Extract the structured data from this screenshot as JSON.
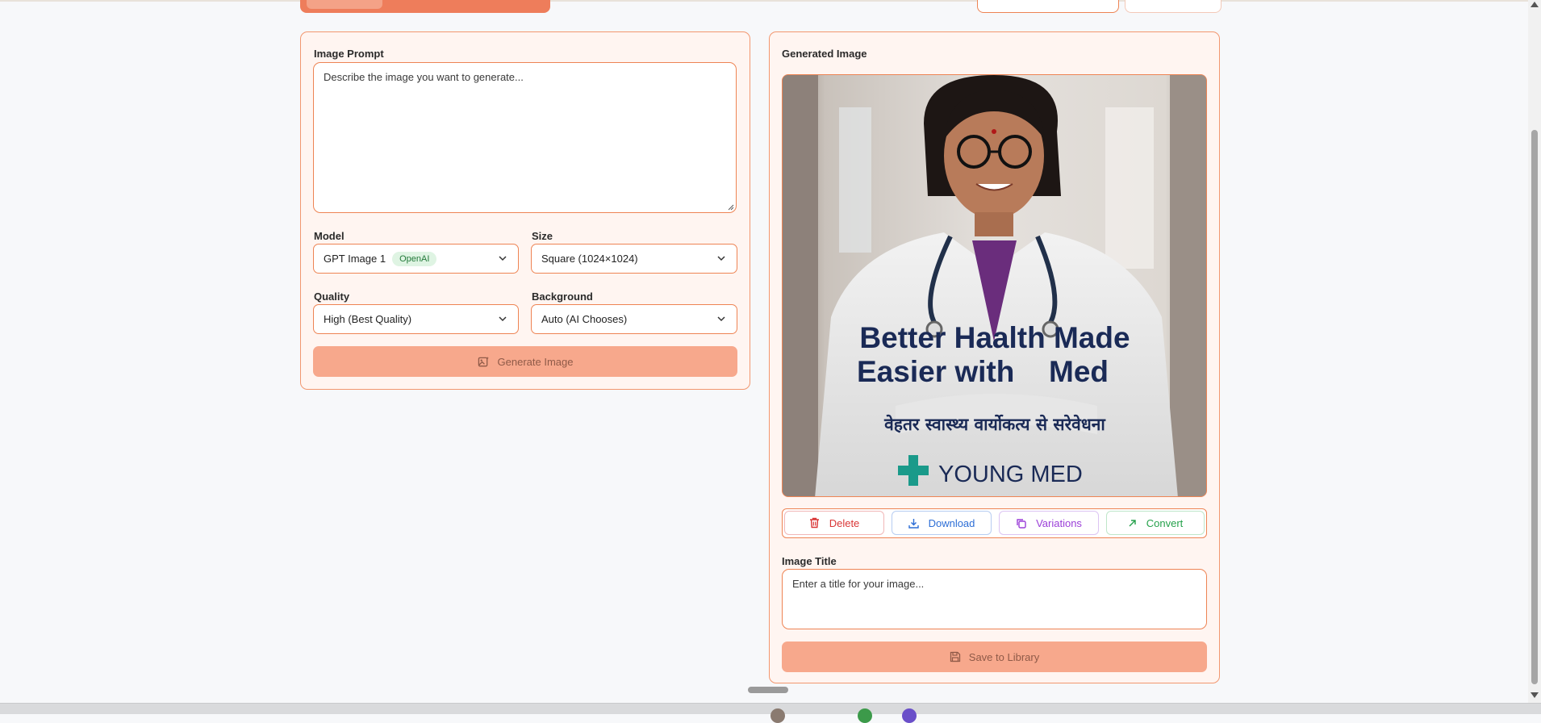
{
  "left_panel": {
    "prompt_label": "Image Prompt",
    "prompt_placeholder": "Describe the image you want to generate...",
    "model_label": "Model",
    "model_value": "GPT Image 1",
    "model_badge": "OpenAI",
    "size_label": "Size",
    "size_value": "Square (1024×1024)",
    "quality_label": "Quality",
    "quality_value": "High (Best Quality)",
    "background_label": "Background",
    "background_value": "Auto (AI Chooses)",
    "generate_button": "Generate Image"
  },
  "right_panel": {
    "title": "Generated Image",
    "image": {
      "headline_line1": "Better Haalth Made",
      "headline_line2": "Easier with",
      "headline_line2_end": "Med",
      "hindi_line": "वेहतर स्वास्थ्य वार्योकत्य से सरेवेधना",
      "brand": "YOUNG MED"
    },
    "actions": {
      "delete": "Delete",
      "download": "Download",
      "variations": "Variations",
      "convert": "Convert"
    },
    "image_title_label": "Image Title",
    "image_title_placeholder": "Enter a title for your image...",
    "save_button": "Save to Library"
  },
  "colors": {
    "accent": "#ee8454",
    "panel_bg": "#fff5f1",
    "button_disabled": "#f7a88c",
    "delete": "#d93636",
    "download": "#2d6ed6",
    "variations": "#9b3fd8",
    "convert": "#25a14b",
    "headline": "#1a2a56",
    "brand_cross": "#1a9a8a"
  }
}
